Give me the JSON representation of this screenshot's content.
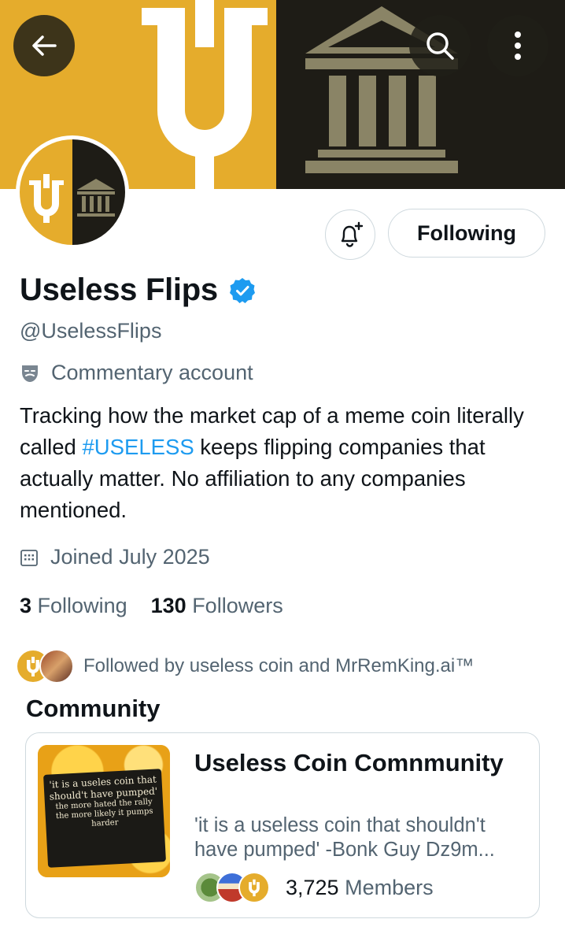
{
  "header": {
    "back_label": "Back",
    "search_label": "Search",
    "more_label": "More options"
  },
  "profile": {
    "name": "Useless Flips",
    "handle": "@UselessFlips",
    "account_label": "Commentary account",
    "bio_before": "Tracking how the market cap of a meme coin literally called ",
    "bio_hashtag": "#USELESS",
    "bio_after": " keeps flipping companies that actually matter.  No affiliation to any companies mentioned.",
    "joined": "Joined July 2025",
    "following_count": "3",
    "following_label": "Following",
    "followers_count": "130",
    "followers_label": "Followers",
    "followed_by": "Followed by useless coin and MrRemKing.ai™"
  },
  "actions": {
    "follow_button": "Following",
    "notify_label": "Notifications"
  },
  "community": {
    "heading": "Community",
    "title": "Useless Coin Comnmunity",
    "description": "'it is a useless coin that shouldn't have pumped' -Bonk Guy Dz9m...",
    "members_count": "3,725",
    "members_label": "Members",
    "image_caption_1": "'it is a useles coin that should't have pumped'",
    "image_caption_2": "the more hated the rally the more likely it pumps harder"
  },
  "colors": {
    "brand_gold": "#e5ac2c",
    "brand_dark": "#1e1c16",
    "link": "#1d9bf0",
    "secondary_text": "#536471",
    "verified": "#1d9bf0"
  },
  "icons": {
    "back": "arrow-left-icon",
    "search": "magnifier-icon",
    "more": "vertical-dots-icon",
    "notify": "bell-plus-icon",
    "verified": "verified-badge-icon",
    "label": "theater-mask-icon",
    "joined": "calendar-icon"
  }
}
